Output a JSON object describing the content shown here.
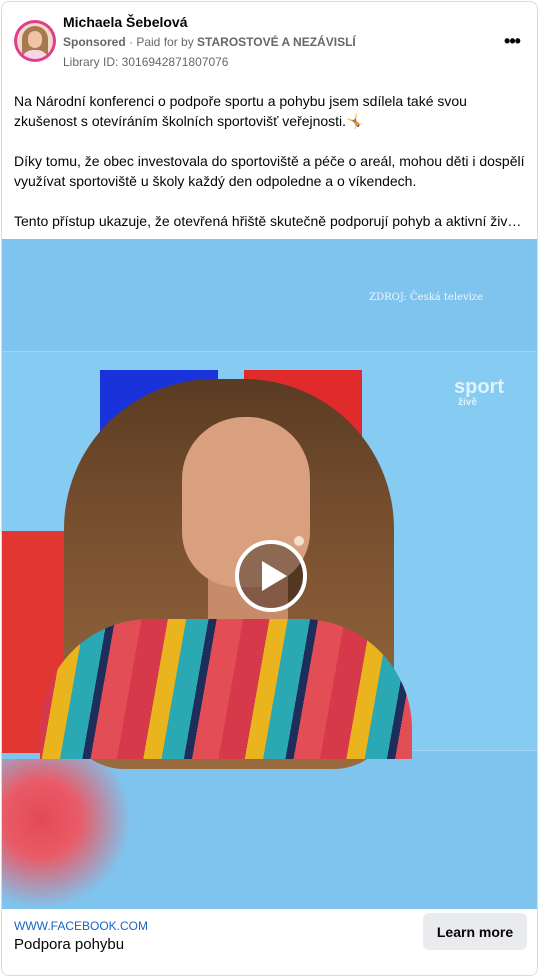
{
  "post": {
    "author": "Michaela Šebelová",
    "sponsored_label": "Sponsored",
    "paid_prefix": " · Paid for by ",
    "payer": "STAROSTOVÉ A NEZÁVISLÍ",
    "library_id": "Library ID: 3016942871807076",
    "more_icon": "more-dots-icon",
    "paragraphs": [
      "Na Národní konferenci o podpoře sportu a pohybu jsem sdílela také svou zkušenost s otevíráním školních sportovišť veřejnosti.🤸",
      "Díky tomu, že obec investovala do sportoviště a péče o areál, mohou děti i dospělí využívat sportoviště u školy každý den odpoledne a o víkendech.",
      "Tento přístup ukazuje, že otevřená hřiště skutečně podporují pohyb a aktivní život..."
    ]
  },
  "video": {
    "source_caption": "ZDROJ: Česká televize",
    "channel_logo": "sport",
    "channel_sub": "živě",
    "play_icon": "play-icon"
  },
  "link": {
    "domain": "WWW.FACEBOOK.COM",
    "headline": "Podpora pohybu",
    "cta_label": "Learn more"
  },
  "colors": {
    "avatar_ring": "#e23d8c",
    "link_blue": "#1a64c2",
    "cta_bg": "#e9ebee"
  }
}
